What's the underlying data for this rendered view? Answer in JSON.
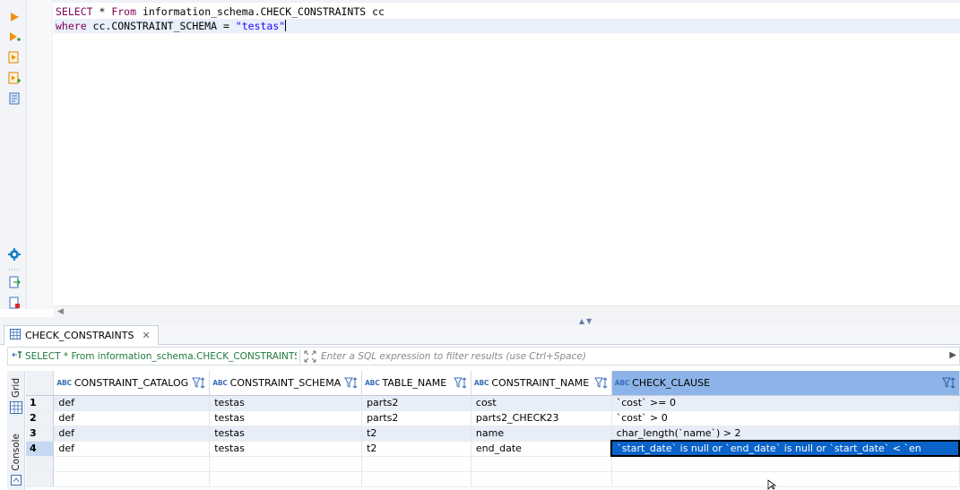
{
  "editor": {
    "line1": {
      "kw1": "SELECT",
      "rest1": " * ",
      "kw2": "From",
      "rest2": " information_schema.CHECK_CONSTRAINTS cc"
    },
    "line2": {
      "kw1": "where",
      "rest1": " cc.CONSTRAINT_SCHEMA = ",
      "str": "\"testas\""
    },
    "toolbar": [
      "execute-statement-icon",
      "execute-statement-new-tab-icon",
      "execute-script-icon",
      "execute-script-new-tab-icon",
      "explain-plan-icon",
      "settings-icon",
      "export-icon",
      "load-script-icon"
    ]
  },
  "results": {
    "tab_label": "CHECK_CONSTRAINTS",
    "query_label": "SELECT * From information_schema.CHECK_CONSTRAINTS c",
    "filter_placeholder": "Enter a SQL expression to filter results (use Ctrl+Space)",
    "side_tabs": {
      "grid": "Grid",
      "console": "Console"
    },
    "columns": [
      {
        "type": "ABC",
        "name": "CONSTRAINT_CATALOG"
      },
      {
        "type": "ABC",
        "name": "CONSTRAINT_SCHEMA"
      },
      {
        "type": "ABC",
        "name": "TABLE_NAME"
      },
      {
        "type": "ABC",
        "name": "CONSTRAINT_NAME"
      },
      {
        "type": "ABC",
        "name": "CHECK_CLAUSE"
      }
    ],
    "rows": [
      {
        "num": "1",
        "cells": [
          "def",
          "testas",
          "parts2",
          "cost",
          "`cost` >= 0"
        ]
      },
      {
        "num": "2",
        "cells": [
          "def",
          "testas",
          "parts2",
          "parts2_CHECK23",
          "`cost` > 0"
        ]
      },
      {
        "num": "3",
        "cells": [
          "def",
          "testas",
          "t2",
          "name",
          "char_length(`name`) > 2"
        ]
      },
      {
        "num": "4",
        "cells": [
          "def",
          "testas",
          "t2",
          "end_date",
          "`start_date` is null or `end_date` is null or `start_date` < `en"
        ]
      }
    ]
  },
  "colors": {
    "keyword": "#7f0055",
    "string": "#2a00ff",
    "query_label": "#1f7a3a",
    "selected_cell": "#0a63c9",
    "active_column_header": "#8db4e8",
    "odd_row": "#e8eef7"
  }
}
